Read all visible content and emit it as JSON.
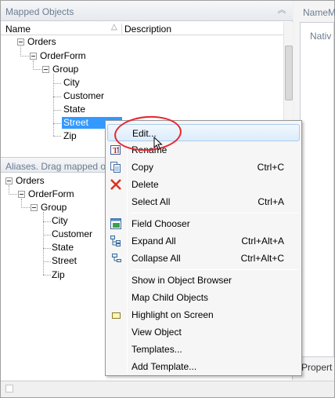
{
  "mapped_objects": {
    "title": "Mapped Objects",
    "collapse_glyph": "︽",
    "columns": {
      "name": "Name",
      "description": "Description",
      "sort_glyph": "△"
    },
    "tree": [
      {
        "label": "Orders"
      },
      {
        "label": "OrderForm"
      },
      {
        "label": "Group"
      },
      {
        "label": "City"
      },
      {
        "label": "Customer"
      },
      {
        "label": "State"
      },
      {
        "label": "Street"
      },
      {
        "label": "Zip"
      }
    ]
  },
  "aliases": {
    "text": "Aliases. Drag mapped obje",
    "tree": [
      {
        "label": "Orders"
      },
      {
        "label": "OrderForm"
      },
      {
        "label": "Group"
      },
      {
        "label": "City"
      },
      {
        "label": "Customer"
      },
      {
        "label": "State"
      },
      {
        "label": "Street"
      },
      {
        "label": "Zip"
      }
    ]
  },
  "right_pane": {
    "title": "NameM",
    "column": "Nativ",
    "bottom_label": "Propert"
  },
  "context_menu": {
    "items": [
      {
        "label": "Edit...",
        "shortcut": "",
        "icon": "none"
      },
      {
        "label": "Rename",
        "shortcut": "",
        "icon": "rename-icon"
      },
      {
        "label": "Copy",
        "shortcut": "Ctrl+C",
        "icon": "copy-icon"
      },
      {
        "label": "Delete",
        "shortcut": "",
        "icon": "delete-icon"
      },
      {
        "label": "Select All",
        "shortcut": "Ctrl+A",
        "icon": "none"
      },
      {
        "label": "Field Chooser",
        "shortcut": "",
        "icon": "field-chooser-icon"
      },
      {
        "label": "Expand All",
        "shortcut": "Ctrl+Alt+A",
        "icon": "expand-all-icon"
      },
      {
        "label": "Collapse All",
        "shortcut": "Ctrl+Alt+C",
        "icon": "collapse-all-icon"
      },
      {
        "label": "Show in Object Browser",
        "shortcut": "",
        "icon": "none"
      },
      {
        "label": "Map Child Objects",
        "shortcut": "",
        "icon": "none"
      },
      {
        "label": "Highlight on Screen",
        "shortcut": "",
        "icon": "highlight-icon"
      },
      {
        "label": "View Object",
        "shortcut": "",
        "icon": "none"
      },
      {
        "label": "Templates...",
        "shortcut": "",
        "icon": "none"
      },
      {
        "label": "Add Template...",
        "shortcut": "",
        "icon": "none"
      }
    ]
  },
  "colors": {
    "selection": "#3399ff",
    "annotation": "#e8252e",
    "header_text": "#6d7d8f"
  }
}
